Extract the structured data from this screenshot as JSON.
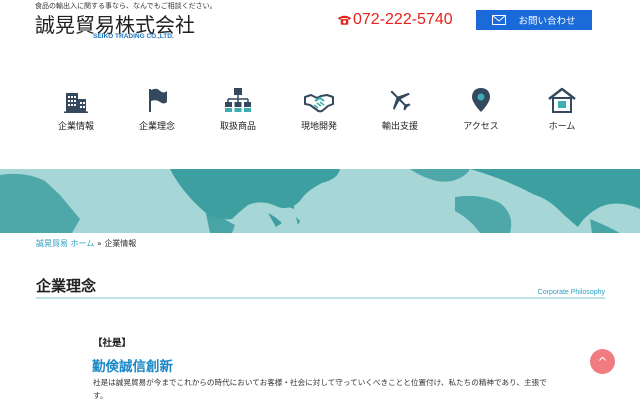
{
  "header": {
    "tagline": "食品の輸出入に関する事なら、なんでもご相談ください。",
    "company_name": "誠晃貿易株式会社",
    "company_name_en": "SEIKO TRADING CO.,LTD.",
    "phone": "072-222-5740",
    "contact_label": "お問い合わせ"
  },
  "nav": [
    {
      "label": "企業情報",
      "icon": "building-icon"
    },
    {
      "label": "企業理念",
      "icon": "flag-icon"
    },
    {
      "label": "取扱商品",
      "icon": "org-chart-icon"
    },
    {
      "label": "現地開発",
      "icon": "handshake-icon"
    },
    {
      "label": "輸出支援",
      "icon": "airplane-icon"
    },
    {
      "label": "アクセス",
      "icon": "map-pin-icon"
    },
    {
      "label": "ホーム",
      "icon": "home-icon"
    }
  ],
  "breadcrumb": {
    "home": "誠晃貿易 ホーム",
    "separator": "»",
    "current": "企業情報"
  },
  "section": {
    "title": "企業理念",
    "subtitle": "Corporate Philosophy"
  },
  "motto": {
    "heading": "【社是】",
    "title": "勤倹誠信創新",
    "text": "社是は誠晃貿易が今までこれからの時代においてお客様・社会に対して守っていくべきことと位置付け、私たちの精神であり、主張です。"
  },
  "back_to_top": "^",
  "colors": {
    "brand_blue": "#1a6ad9",
    "phone_red": "#e5231b",
    "accent_teal": "#2a9fc2",
    "map_bg": "#a6d6d6",
    "map_land": "#3e9fa0",
    "top_button": "#f07b81"
  }
}
